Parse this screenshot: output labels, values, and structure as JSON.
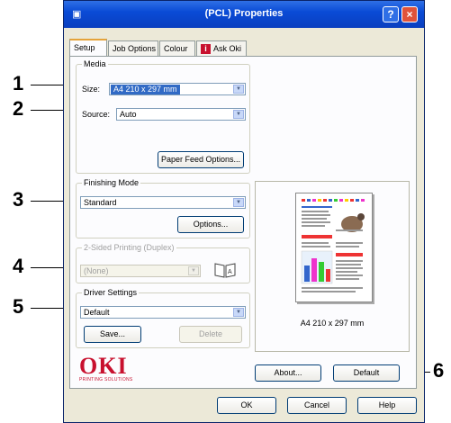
{
  "window": {
    "title": "(PCL) Properties",
    "help_button": "?",
    "close_button": "×"
  },
  "tabs": [
    {
      "label": "Setup"
    },
    {
      "label": "Job Options"
    },
    {
      "label": "Colour"
    },
    {
      "label": "Ask Oki"
    }
  ],
  "media": {
    "legend": "Media",
    "size_label": "Size:",
    "size_value": "A4 210 x 297 mm",
    "source_label": "Source:",
    "source_value": "Auto",
    "paper_feed_button": "Paper Feed Options..."
  },
  "finishing": {
    "legend": "Finishing Mode",
    "value": "Standard",
    "options_button": "Options..."
  },
  "duplex": {
    "legend": "2-Sided Printing (Duplex)",
    "value": "(None)"
  },
  "driver": {
    "legend": "Driver Settings",
    "value": "Default",
    "save_button": "Save...",
    "delete_button": "Delete"
  },
  "preview": {
    "caption": "A4 210 x 297 mm"
  },
  "logo": {
    "text": "OKI",
    "tagline": "PRINTING SOLUTIONS"
  },
  "buttons": {
    "about": "About...",
    "default": "Default",
    "ok": "OK",
    "cancel": "Cancel",
    "help": "Help"
  },
  "callouts": [
    "1",
    "2",
    "3",
    "4",
    "5",
    "6"
  ],
  "colors": {
    "titlebar": "#0a4bd6",
    "oki_red": "#c8102e",
    "selection": "#316ac5"
  }
}
